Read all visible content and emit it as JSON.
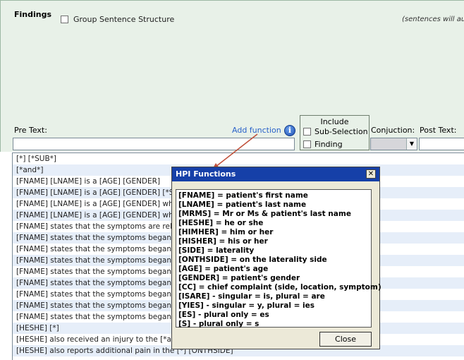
{
  "findings": {
    "label": "Findings",
    "group_sentence_label": "Group Sentence Structure",
    "group_sentence_checked": false,
    "auto_note": "(sentences will auto"
  },
  "pretext": {
    "label": "Pre Text:",
    "value": ""
  },
  "add_function": {
    "label": "Add function",
    "icon": "info-icon",
    "icon_glyph": "i"
  },
  "include": {
    "title": "Include",
    "options": [
      {
        "label": "Sub-Selection",
        "checked": false
      },
      {
        "label": "Finding",
        "checked": false
      }
    ]
  },
  "conjunction": {
    "label": "Conjuction:",
    "value": "",
    "arrow": "▼"
  },
  "posttext": {
    "label": "Post Text:",
    "value": ""
  },
  "sentences": [
    "[*] [*SUB*]",
    "[*and*]",
    "[FNAME] [LNAME] is a [AGE] [GENDER]",
    "[FNAME] [LNAME] is a [AGE] [GENDER] [*SUB",
    "[FNAME] [LNAME] is a [AGE] [GENDER] who",
    "[FNAME] [LNAME] is a [AGE] [GENDER] who",
    "[FNAME] states that the symptoms are relie",
    "[FNAME] states that the symptoms began a",
    "[FNAME] states that the symptoms began a",
    "[FNAME] states that the symptoms began a",
    "[FNAME] states that the symptoms began a",
    "[FNAME] states that the symptoms began a",
    "[FNAME] states that the symptoms began a",
    "[FNAME] states that the symptoms began a",
    "[FNAME] states that the symptoms began a",
    "[HESHE] [*]",
    "[HESHE] also received an injury to the [*and",
    "[HESHE] also reports additional pain in the [*] [ONTHSIDE]"
  ],
  "dialog": {
    "title": "HPI Functions",
    "close_x": "✕",
    "functions": [
      "[FNAME] = patient's first name",
      "[LNAME] = patient's last name",
      "[MRMS] = Mr or Ms & patient's last name",
      "[HESHE] = he or she",
      "[HIMHER] = him or her",
      "[HISHER] = his or her",
      "[SIDE] = laterality",
      "[ONTHSIDE] = on the laterality side",
      "[AGE] = patient's age",
      "[GENDER] = patient's gender",
      "[CC] = chief complaint (side, location, symptom)",
      "[ISARE] - singular = is, plural = are",
      "[YIES] - singular = y, plural = ies",
      "[ES] - plural only = es",
      "[S] - plural only = s"
    ],
    "close_button": "Close"
  },
  "colors": {
    "panel_bg": "#e8f1e8",
    "titlebar": "#1640a8",
    "link": "#2a62c9",
    "arrow": "#c0503a",
    "alt_row": "#e6eef9"
  }
}
